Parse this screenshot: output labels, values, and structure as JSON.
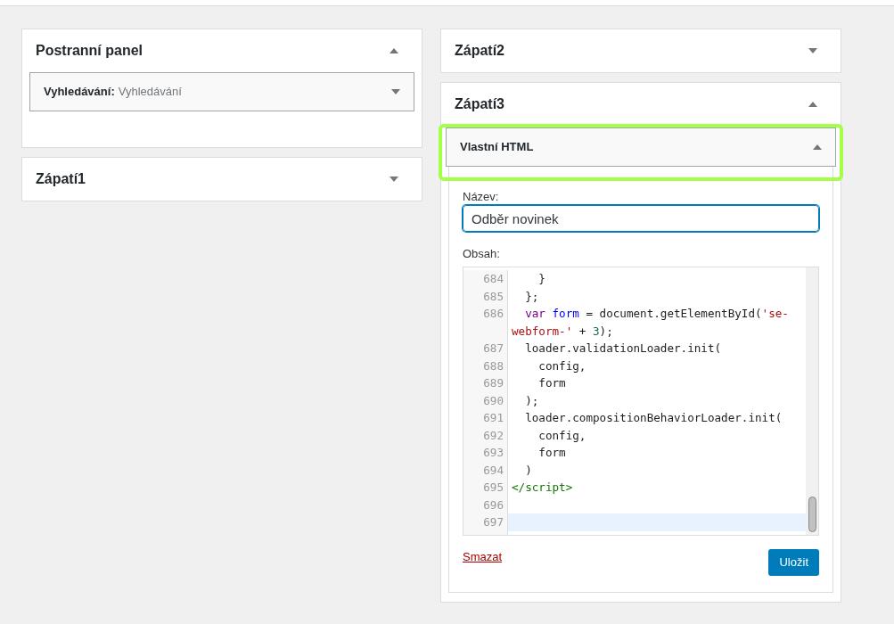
{
  "columns": [
    {
      "areas": [
        {
          "title": "Postranní panel",
          "expanded": true,
          "widgets": [
            {
              "title": "Vyhledávání:",
              "subtitle": "Vyhledávání",
              "expanded": false,
              "highlighted": false
            }
          ]
        },
        {
          "title": "Zápatí1",
          "expanded": false
        }
      ]
    },
    {
      "areas": [
        {
          "title": "Zápatí2",
          "expanded": false
        },
        {
          "title": "Zápatí3",
          "expanded": true,
          "widgets": [
            {
              "title": "Vlastní HTML",
              "expanded": true,
              "highlighted": true,
              "form": {
                "title_label": "Název:",
                "title_value": "Odběr novinek",
                "content_label": "Obsah:",
                "code_lines": [
                  {
                    "number": "684",
                    "active": false,
                    "tokens": [
                      {
                        "kind": "plain",
                        "text": "    }"
                      }
                    ]
                  },
                  {
                    "number": "685",
                    "active": false,
                    "tokens": [
                      {
                        "kind": "plain",
                        "text": "  };"
                      }
                    ]
                  },
                  {
                    "number": "686",
                    "active": false,
                    "tokens": [
                      {
                        "kind": "keyword",
                        "text": "  var"
                      },
                      {
                        "kind": "def",
                        "text": " form"
                      },
                      {
                        "kind": "plain",
                        "text": " = document.getElementById("
                      },
                      {
                        "kind": "string",
                        "text": "'se-webform-'"
                      },
                      {
                        "kind": "plain",
                        "text": " + "
                      },
                      {
                        "kind": "number",
                        "text": "3"
                      },
                      {
                        "kind": "plain",
                        "text": ");"
                      }
                    ]
                  },
                  {
                    "number": "687",
                    "active": false,
                    "tokens": [
                      {
                        "kind": "plain",
                        "text": "  loader.validationLoader.init("
                      }
                    ]
                  },
                  {
                    "number": "688",
                    "active": false,
                    "tokens": [
                      {
                        "kind": "plain",
                        "text": "    config,"
                      }
                    ]
                  },
                  {
                    "number": "689",
                    "active": false,
                    "tokens": [
                      {
                        "kind": "plain",
                        "text": "    form"
                      }
                    ]
                  },
                  {
                    "number": "690",
                    "active": false,
                    "tokens": [
                      {
                        "kind": "plain",
                        "text": "  );"
                      }
                    ]
                  },
                  {
                    "number": "691",
                    "active": false,
                    "tokens": [
                      {
                        "kind": "plain",
                        "text": "  loader.compositionBehaviorLoader.init("
                      }
                    ]
                  },
                  {
                    "number": "692",
                    "active": false,
                    "tokens": [
                      {
                        "kind": "plain",
                        "text": "    config,"
                      }
                    ]
                  },
                  {
                    "number": "693",
                    "active": false,
                    "tokens": [
                      {
                        "kind": "plain",
                        "text": "    form"
                      }
                    ]
                  },
                  {
                    "number": "694",
                    "active": false,
                    "tokens": [
                      {
                        "kind": "plain",
                        "text": "  )"
                      }
                    ]
                  },
                  {
                    "number": "695",
                    "active": false,
                    "tokens": [
                      {
                        "kind": "tag",
                        "text": "</script>"
                      }
                    ]
                  },
                  {
                    "number": "696",
                    "active": false
                  },
                  {
                    "number": "697",
                    "active": true
                  }
                ],
                "delete_link": "Smazat",
                "save_button": "Uložit"
              }
            }
          ]
        }
      ]
    }
  ]
}
